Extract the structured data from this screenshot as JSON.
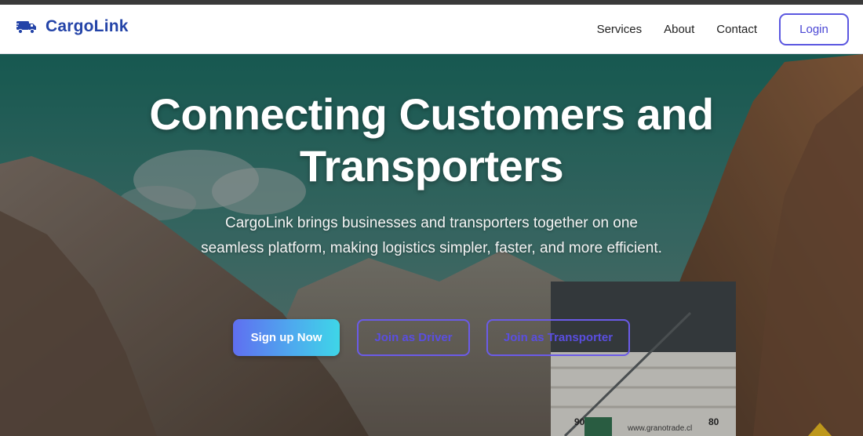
{
  "brand": {
    "name": "CargoLink",
    "icon": "truck-icon"
  },
  "nav": {
    "links": [
      {
        "label": "Services"
      },
      {
        "label": "About"
      },
      {
        "label": "Contact"
      }
    ],
    "login_label": "Login"
  },
  "hero": {
    "title_line1": "Connecting Customers and",
    "title_line2": "Transporters",
    "subtitle": "CargoLink brings businesses and transporters together on one seamless platform, making logistics simpler, faster, and more efficient.",
    "buttons": {
      "signup": "Sign up Now",
      "driver": "Join as Driver",
      "transporter": "Join as Transporter"
    },
    "truck_plate_left": "90",
    "truck_plate_right": "80",
    "truck_url": "www.granotrade.cl"
  },
  "colors": {
    "brand": "#2444a8",
    "accent": "#5b57e0",
    "gradient_start": "#5f6ff0",
    "gradient_end": "#3ed6e8"
  }
}
